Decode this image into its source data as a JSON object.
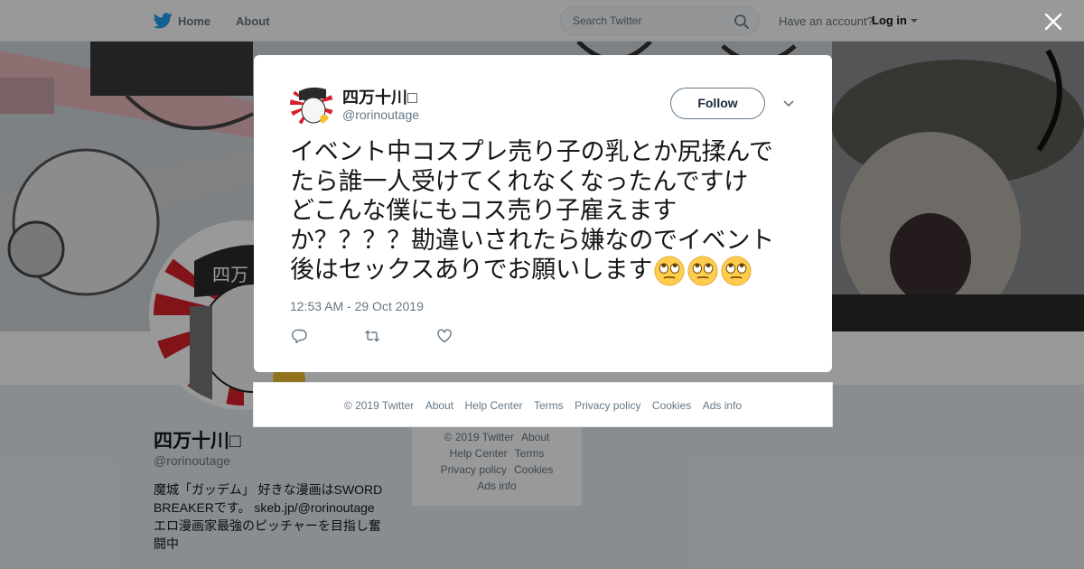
{
  "topnav": {
    "home_label": "Home",
    "about_label": "About",
    "search_placeholder": "Search Twitter",
    "have_account": "Have an account?",
    "login_label": "Log in"
  },
  "profile": {
    "name": "四万十川□",
    "handle": "@rorinoutage",
    "bio_lines": [
      "魔城「ガッデム」 好きな漫画はSWORD",
      "BREAKERです。 skeb.jp/@rorinoutage",
      "エロ漫画家最強のピッチャーを目指し奮",
      "闘中"
    ]
  },
  "side_footer": {
    "row1": [
      "© 2019 Twitter",
      "About"
    ],
    "row2": [
      "Help Center",
      "Terms"
    ],
    "row3": [
      "Privacy policy",
      "Cookies"
    ],
    "row4": [
      "Ads info"
    ]
  },
  "modal": {
    "user_name": "四万十川□",
    "user_handle": "@rorinoutage",
    "follow_label": "Follow",
    "tweet_lines": [
      "イベント中コスプレ売り子の乳とか尻揉んで",
      "たら誰一人受けてくれなくなったんですけ",
      "どこんな僕にもコス売り子雇えます",
      "か？？？？勘違いされたら嫌なのでイベント",
      "後はセックスありでお願いします"
    ],
    "emoji_name": "face-with-rolling-eyes",
    "emoji_count": 3,
    "timestamp": "12:53 AM - 29 Oct 2019"
  },
  "modal_footer": {
    "links": [
      "© 2019 Twitter",
      "About",
      "Help Center",
      "Terms",
      "Privacy policy",
      "Cookies",
      "Ads info"
    ]
  },
  "colors": {
    "link_gray": "#657786",
    "twitter_blue": "#1da1f2",
    "text_dark": "#14171a",
    "emoji_yellow": "#ffcc4d"
  }
}
